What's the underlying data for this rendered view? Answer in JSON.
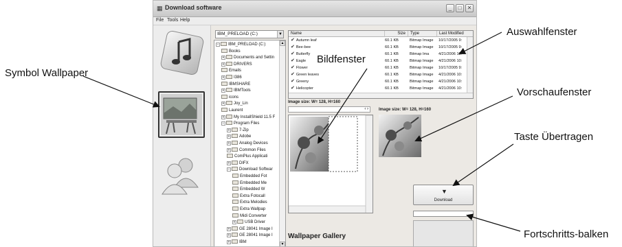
{
  "window": {
    "title": "Download software",
    "controls": [
      "_",
      "□",
      "✕"
    ]
  },
  "menu": [
    "File",
    "Tools",
    "Help"
  ],
  "left_icons": [
    {
      "name": "music-note-icon",
      "selected": false
    },
    {
      "name": "wallpaper-icon",
      "selected": true
    },
    {
      "name": "contacts-icon",
      "selected": false
    }
  ],
  "drive_combo": {
    "value": "IBM_PRELOAD (C:)"
  },
  "tree": [
    {
      "label": "IBM_PRELOAD (C:)",
      "depth": 0,
      "expander": "-"
    },
    {
      "label": "Books",
      "depth": 1,
      "expander": ""
    },
    {
      "label": "Documents and Settin",
      "depth": 1,
      "expander": "+"
    },
    {
      "label": "DRIVERS",
      "depth": 1,
      "expander": "+"
    },
    {
      "label": "Emails",
      "depth": 1,
      "expander": ""
    },
    {
      "label": "I386",
      "depth": 1,
      "expander": "+"
    },
    {
      "label": "IBMSHARE",
      "depth": 1,
      "expander": ""
    },
    {
      "label": "IBMTools",
      "depth": 1,
      "expander": "+"
    },
    {
      "label": "icons",
      "depth": 1,
      "expander": ""
    },
    {
      "label": "Joy_Lin",
      "depth": 1,
      "expander": "+"
    },
    {
      "label": "Laurent",
      "depth": 1,
      "expander": ""
    },
    {
      "label": "My InstallShield 11.5 F",
      "depth": 1,
      "expander": "+"
    },
    {
      "label": "Program Files",
      "depth": 1,
      "expander": "-"
    },
    {
      "label": "7-Zip",
      "depth": 2,
      "expander": "+"
    },
    {
      "label": "Adobe",
      "depth": 2,
      "expander": "+"
    },
    {
      "label": "Analog Devices",
      "depth": 2,
      "expander": "+"
    },
    {
      "label": "Common Files",
      "depth": 2,
      "expander": "+"
    },
    {
      "label": "ComPlus Applicati",
      "depth": 2,
      "expander": ""
    },
    {
      "label": "DIFX",
      "depth": 2,
      "expander": "+"
    },
    {
      "label": "Download Softwar",
      "depth": 2,
      "expander": "-"
    },
    {
      "label": "Embedded Fot",
      "depth": 3,
      "expander": ""
    },
    {
      "label": "Embedded Me",
      "depth": 3,
      "expander": ""
    },
    {
      "label": "Embedded W",
      "depth": 3,
      "expander": ""
    },
    {
      "label": "Extra Fotocall",
      "depth": 3,
      "expander": ""
    },
    {
      "label": "Extra Melodies",
      "depth": 3,
      "expander": ""
    },
    {
      "label": "Extra Wallpap",
      "depth": 3,
      "expander": ""
    },
    {
      "label": "Midi Converter",
      "depth": 3,
      "expander": ""
    },
    {
      "label": "USB Driver",
      "depth": 3,
      "expander": "+"
    },
    {
      "label": "GE 28041 Image I",
      "depth": 2,
      "expander": "+"
    },
    {
      "label": "GE 28041 Image I",
      "depth": 2,
      "expander": "+"
    },
    {
      "label": "IBM",
      "depth": 2,
      "expander": "+"
    }
  ],
  "file_list": {
    "columns": [
      "Name",
      "Size",
      "Type",
      "Last Modified"
    ],
    "rows": [
      {
        "name": "Autumn leaf",
        "size": "60.1 KB",
        "type": "Bitmap Image",
        "modified": "10/17/2005 9:"
      },
      {
        "name": "Bee-bee",
        "size": "60.1 KB",
        "type": "Bitmap Image",
        "modified": "10/17/2005 9:"
      },
      {
        "name": "Butterfly",
        "size": "60.1 KB",
        "type": "Bitmap Ima",
        "modified": "4/21/2006 10:"
      },
      {
        "name": "Eagle",
        "size": "60.1 KB",
        "type": "Bitmap Image",
        "modified": "4/21/2006 10:"
      },
      {
        "name": "Flower",
        "size": "60.1 KB",
        "type": "Bitmap Image",
        "modified": "10/17/2005 9:"
      },
      {
        "name": "Green leaves",
        "size": "60.1 KB",
        "type": "Bitmap Image",
        "modified": "4/21/2006 10:"
      },
      {
        "name": "Greeny",
        "size": "60.1 KB",
        "type": "Bitmap Image",
        "modified": "4/21/2006 10:"
      },
      {
        "name": "Helicopter",
        "size": "60.1 KB",
        "type": "Bitmap Image",
        "modified": "4/21/2006 10:"
      }
    ]
  },
  "image_size_label": "Image size: W= 128, H=160",
  "preview_size_label": "Image size: W= 128, H=160",
  "download_button": {
    "label": "Download",
    "icon": "download-icon"
  },
  "progress": {
    "value": 0
  },
  "gallery_title": "Wallpaper Gallery",
  "callouts": {
    "auswahl": "Auswahlfenster",
    "bild": "Bildfenster",
    "symbol": "Symbol Wallpaper",
    "vorschau": "Vorschaufenster",
    "taste": "Taste Übertragen",
    "fortschritt": "Fortschritts-balken"
  }
}
